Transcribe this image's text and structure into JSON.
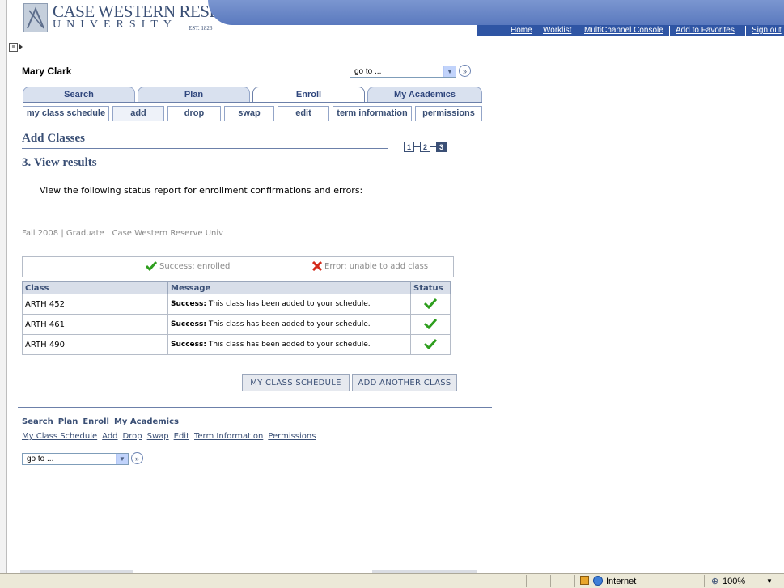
{
  "header": {
    "logo_name": "CASE WESTERN RESERVE",
    "logo_sub": "UNIVERSITY",
    "logo_est": "EST. 1826",
    "nav": [
      "Home",
      "Worklist",
      "MultiChannel Console",
      "Add to Favorites",
      "Sign out"
    ]
  },
  "student_name": "Mary Clark",
  "goto_top": "go to ...",
  "tabs": [
    "Search",
    "Plan",
    "Enroll",
    "My Academics"
  ],
  "subtabs": [
    "my class schedule",
    "add",
    "drop",
    "swap",
    "edit",
    "term information",
    "permissions"
  ],
  "page_title": "Add Classes",
  "steps": [
    "1",
    "2",
    "3"
  ],
  "section_title": "3.  View results",
  "instructions": "View the following status report for enrollment confirmations and errors:",
  "term_info": "Fall 2008 | Graduate | Case Western Reserve Univ",
  "legend": {
    "success": "Success: enrolled",
    "error": "Error: unable to add class",
    "success_color": "#2e9e1e",
    "error_color": "#d42a1a"
  },
  "results_table": {
    "headers": [
      "Class",
      "Message",
      "Status"
    ],
    "rows": [
      {
        "class": "ARTH  452",
        "msg_bold": "Success:",
        "msg_rest": " This class has been added to your schedule."
      },
      {
        "class": "ARTH  461",
        "msg_bold": "Success:",
        "msg_rest": " This class has been added to your schedule."
      },
      {
        "class": "ARTH  490",
        "msg_bold": "Success:",
        "msg_rest": " This class has been added to your schedule."
      }
    ]
  },
  "buttons": {
    "my_class_schedule": "MY CLASS SCHEDULE",
    "add_another": "ADD ANOTHER CLASS"
  },
  "footer": {
    "links1": [
      "Search",
      "Plan",
      "Enroll",
      "My Academics"
    ],
    "links2": [
      "My Class Schedule",
      "Add",
      "Drop",
      "Swap",
      "Edit",
      "Term Information",
      "Permissions"
    ],
    "goto": "go to ..."
  },
  "statusbar": {
    "zone": "Internet",
    "zoom": "100%"
  }
}
